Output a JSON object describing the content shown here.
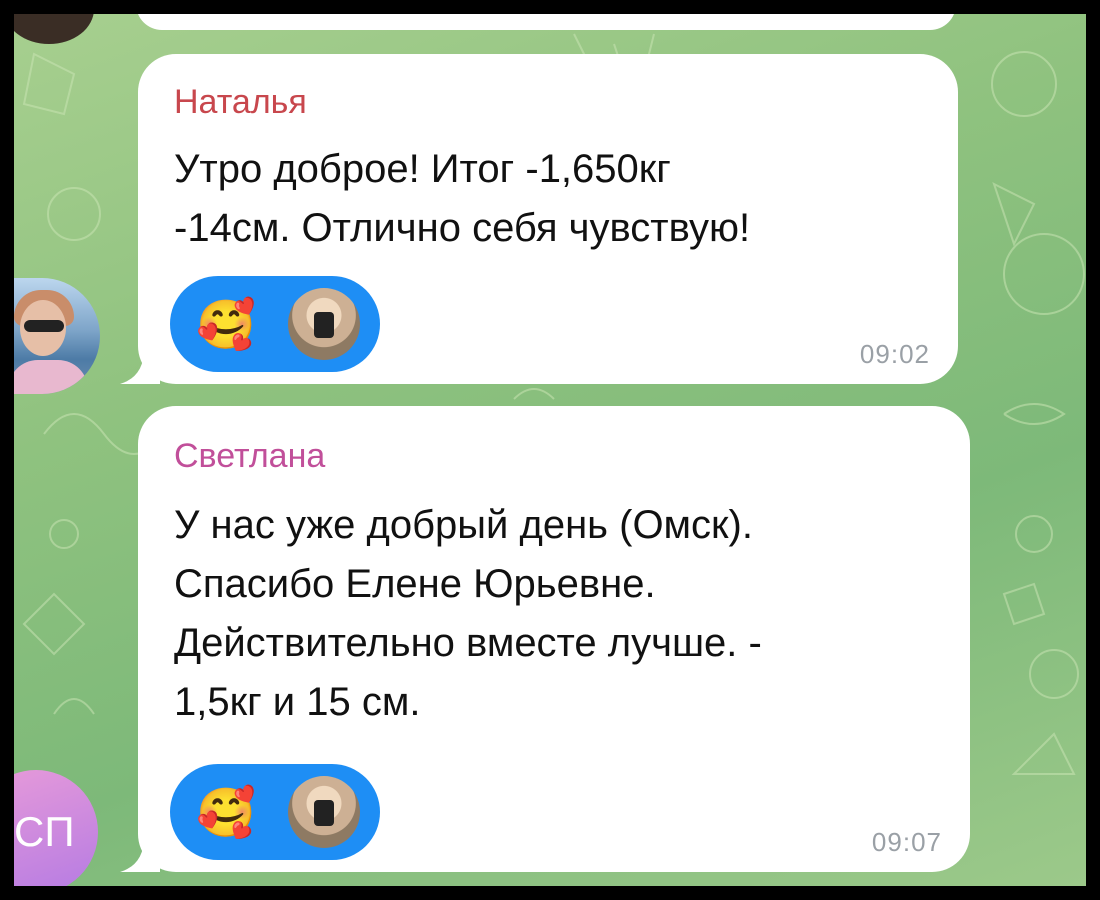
{
  "messages": [
    {
      "sender": "Наталья",
      "sender_color": "#c8474d",
      "text_lines": [
        "Утро доброе! Итог -1,650кг",
        "-14см. Отлично себя чувствую!"
      ],
      "reaction_emoji": "🥰",
      "time": "09:02",
      "avatar": "user-photo"
    },
    {
      "sender": "Светлана",
      "sender_color": "#c14f9a",
      "text_lines": [
        "У нас уже добрый день (Омск).",
        "Спасибо Елене Юрьевне.",
        "Действительно вместе лучше. -",
        "1,5кг и 15 см."
      ],
      "reaction_emoji": "🥰",
      "time": "09:07",
      "avatar_initials": "СП"
    }
  ],
  "colors": {
    "reaction_bg": "#1e8ef5",
    "bubble_bg": "#ffffff",
    "time_color": "#9aa0a6",
    "chat_bg": "#8fc27f"
  },
  "icons": [
    "smiling-face-with-hearts-emoji",
    "reactor-avatar",
    "bubble-tail"
  ]
}
